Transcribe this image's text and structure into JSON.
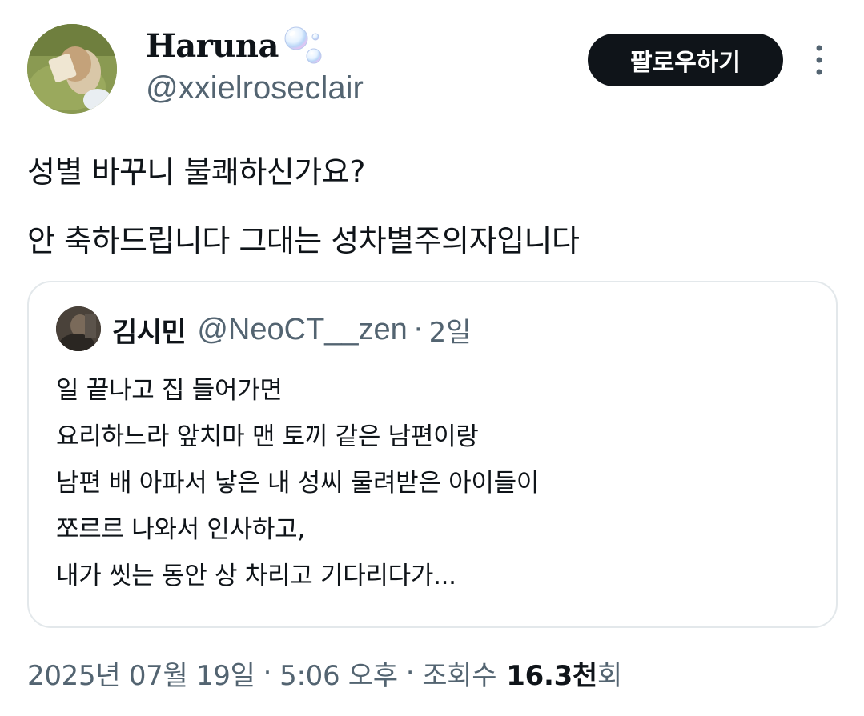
{
  "author": {
    "display_name": "Haruna",
    "handle": "@xxielroseclair",
    "name_emoji": "bubbles-icon"
  },
  "header": {
    "follow_label": "팔로우하기",
    "more_icon": "more-vertical-icon"
  },
  "tweet": {
    "lines": [
      "성별 바꾸니 불쾌하신가요?",
      "안 축하드립니다 그대는 성차별주의자입니다"
    ]
  },
  "quote": {
    "name": "김시민",
    "handle": "@NeoCT__zen",
    "separator": "·",
    "time": "2일",
    "lines": [
      "일 끝나고 집 들어가면",
      "요리하느라 앞치마 맨 토끼 같은 남편이랑",
      "남편 배 아파서 낳은 내 성씨 물려받은 아이들이",
      "쪼르르 나와서 인사하고,",
      "내가 씻는 동안 상 차리고 기다리다가..."
    ]
  },
  "meta": {
    "date": "2025년 07월 19일",
    "separator": "·",
    "time": "5:06 오후",
    "views_label": "조회수",
    "views_count": "16.3천",
    "views_suffix": "회"
  },
  "colors": {
    "text": "#0f1419",
    "secondary": "#536471",
    "border": "#e3e8eb",
    "follow_bg": "#0f1419",
    "follow_text": "#ffffff"
  }
}
